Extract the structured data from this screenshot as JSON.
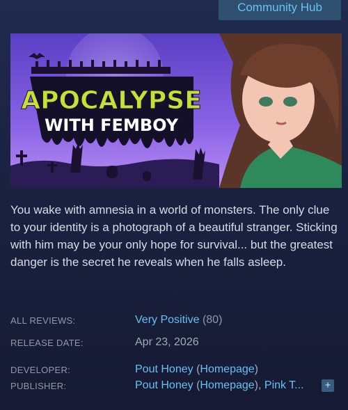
{
  "header": {
    "community_hub": "Community Hub"
  },
  "capsule": {
    "title_line1": "APOCALYPSE",
    "title_line2": "WITH FEMBOY"
  },
  "description": "You wake with amnesia in a world of monsters. The only clue to your identity is a photograph of a beautiful stranger. Sticking with him may be your only hope for survival... but the greatest danger is the secret he reveals when he falls asleep.",
  "reviews": {
    "label": "ALL REVIEWS:",
    "summary": "Very Positive",
    "count": "(80)"
  },
  "release": {
    "label": "RELEASE DATE:",
    "date": "Apr 23, 2026"
  },
  "developer": {
    "label": "DEVELOPER:",
    "name": "Pout Honey",
    "open": "(",
    "homepage": "Homepage",
    "close": ")"
  },
  "publisher": {
    "label": "PUBLISHER:",
    "name": "Pout Honey",
    "open": "(",
    "homepage": "Homepage",
    "close": "), ",
    "extra": "Pink T...",
    "more": "+"
  },
  "colors": {
    "link": "#67c1f5",
    "title_green": "#c7e034",
    "sky": "#7d5bdc"
  }
}
